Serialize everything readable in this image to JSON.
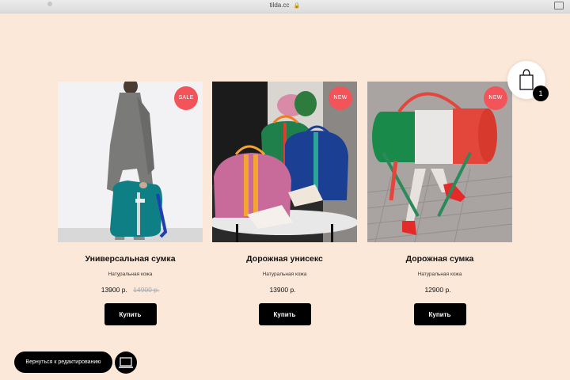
{
  "browser": {
    "url": "tilda.cc"
  },
  "cart": {
    "count": "1"
  },
  "products": [
    {
      "badge": "SALE",
      "title": "Универсальная сумка",
      "subtitle": "Натуральная кожа",
      "price": "13900 р.",
      "old_price": "14900 р.",
      "button": "Купить"
    },
    {
      "badge": "NEW",
      "title": "Дорожная унисекс",
      "subtitle": "Натуральная кожа",
      "price": "13900 р.",
      "old_price": "",
      "button": "Купить"
    },
    {
      "badge": "NEW",
      "title": "Дорожная сумка",
      "subtitle": "Натуральная кожа",
      "price": "12900 р.",
      "old_price": "",
      "button": "Купить"
    }
  ],
  "editor": {
    "back_label": "Вернуться к редактированию"
  },
  "colors": {
    "background": "#fce8d9",
    "badge": "#f3545a",
    "button": "#000000"
  }
}
